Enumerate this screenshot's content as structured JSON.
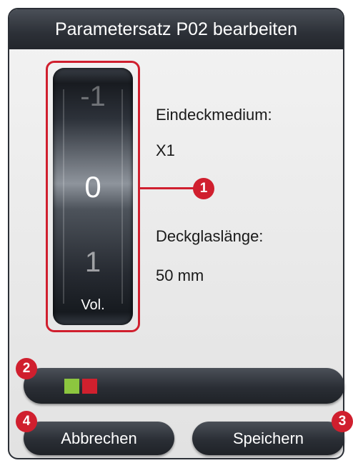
{
  "dialog": {
    "title": "Parametersatz P02 bearbeiten"
  },
  "wheel": {
    "previous_value": "-1",
    "current_value": "0",
    "next_value": "1",
    "label": "Vol."
  },
  "info": {
    "medium_label": "Eindeckmedium:",
    "medium_value": "X1",
    "coverslip_label": "Deckglaslänge:",
    "coverslip_value": "50 mm"
  },
  "status_bar": {
    "indicators": [
      {
        "color": "#8cc63f"
      },
      {
        "color": "#d0202e"
      }
    ]
  },
  "buttons": {
    "cancel_label": "Abbrechen",
    "save_label": "Speichern"
  },
  "callouts": {
    "wheel": "1",
    "status_bar": "2",
    "save": "3",
    "cancel": "4"
  },
  "colors": {
    "callout_red": "#d01f2e",
    "titlebar": "#2c3037"
  }
}
